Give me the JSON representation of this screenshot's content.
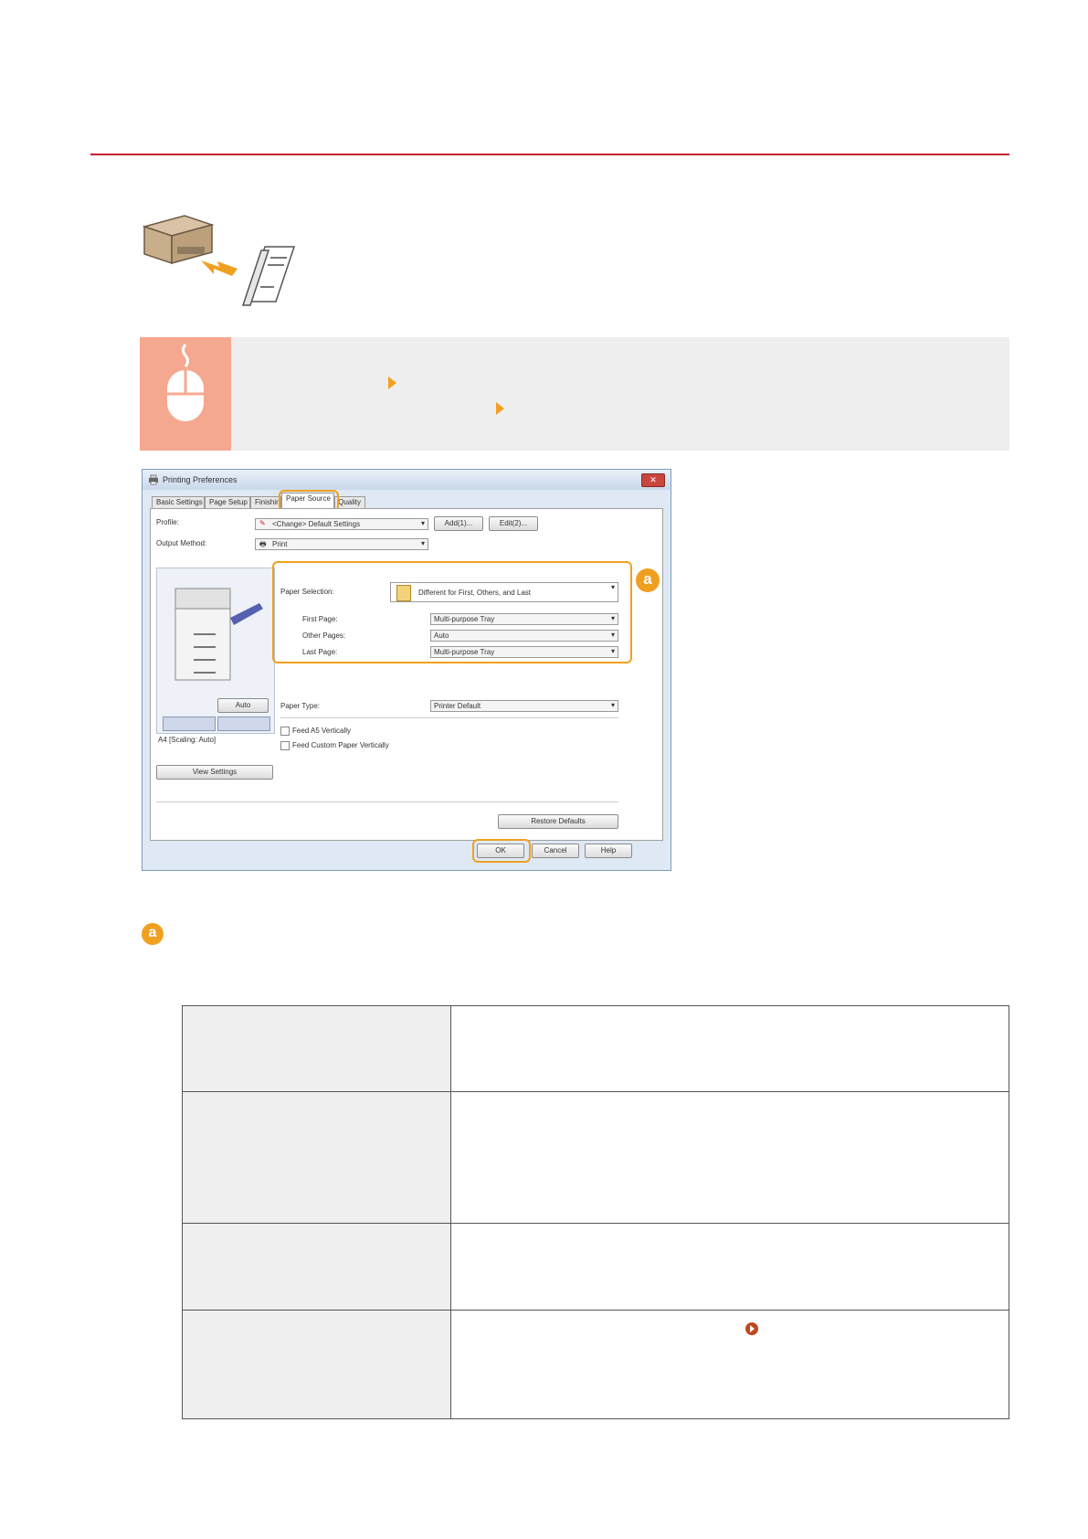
{
  "dialog": {
    "title": "Printing Preferences",
    "close_label": "✕",
    "tabs": [
      "Basic Settings",
      "Page Setup",
      "Finishing",
      "Paper Source",
      "Quality"
    ],
    "active_tab": "Paper Source",
    "profile_label": "Profile:",
    "profile_value": "<Change> Default Settings",
    "add_button": "Add(1)...",
    "edit_button": "Edit(2)...",
    "output_method_label": "Output Method:",
    "output_method_value": "Print",
    "paper_selection_label": "Paper Selection:",
    "paper_selection_value": "Different for First, Others, and Last",
    "first_page_label": "First Page:",
    "first_page_value": "Multi-purpose Tray",
    "other_pages_label": "Other Pages:",
    "other_pages_value": "Auto",
    "last_page_label": "Last Page:",
    "last_page_value": "Multi-purpose Tray",
    "auto_button": "Auto",
    "preview_caption": "A4 [Scaling: Auto]",
    "view_settings_button": "View Settings",
    "paper_type_label": "Paper Type:",
    "paper_type_value": "Printer Default",
    "feed_a5_label": "Feed A5 Vertically",
    "feed_custom_label": "Feed Custom Paper Vertically",
    "restore_defaults_button": "Restore Defaults",
    "ok_button": "OK",
    "cancel_button": "Cancel",
    "help_button": "Help",
    "callout": "a"
  },
  "section_marker": "a",
  "colors": {
    "accent_red": "#c8102e",
    "highlight_orange": "#f0a020",
    "banner_bg": "#eeeeee",
    "mouse_box": "#f5a890"
  }
}
